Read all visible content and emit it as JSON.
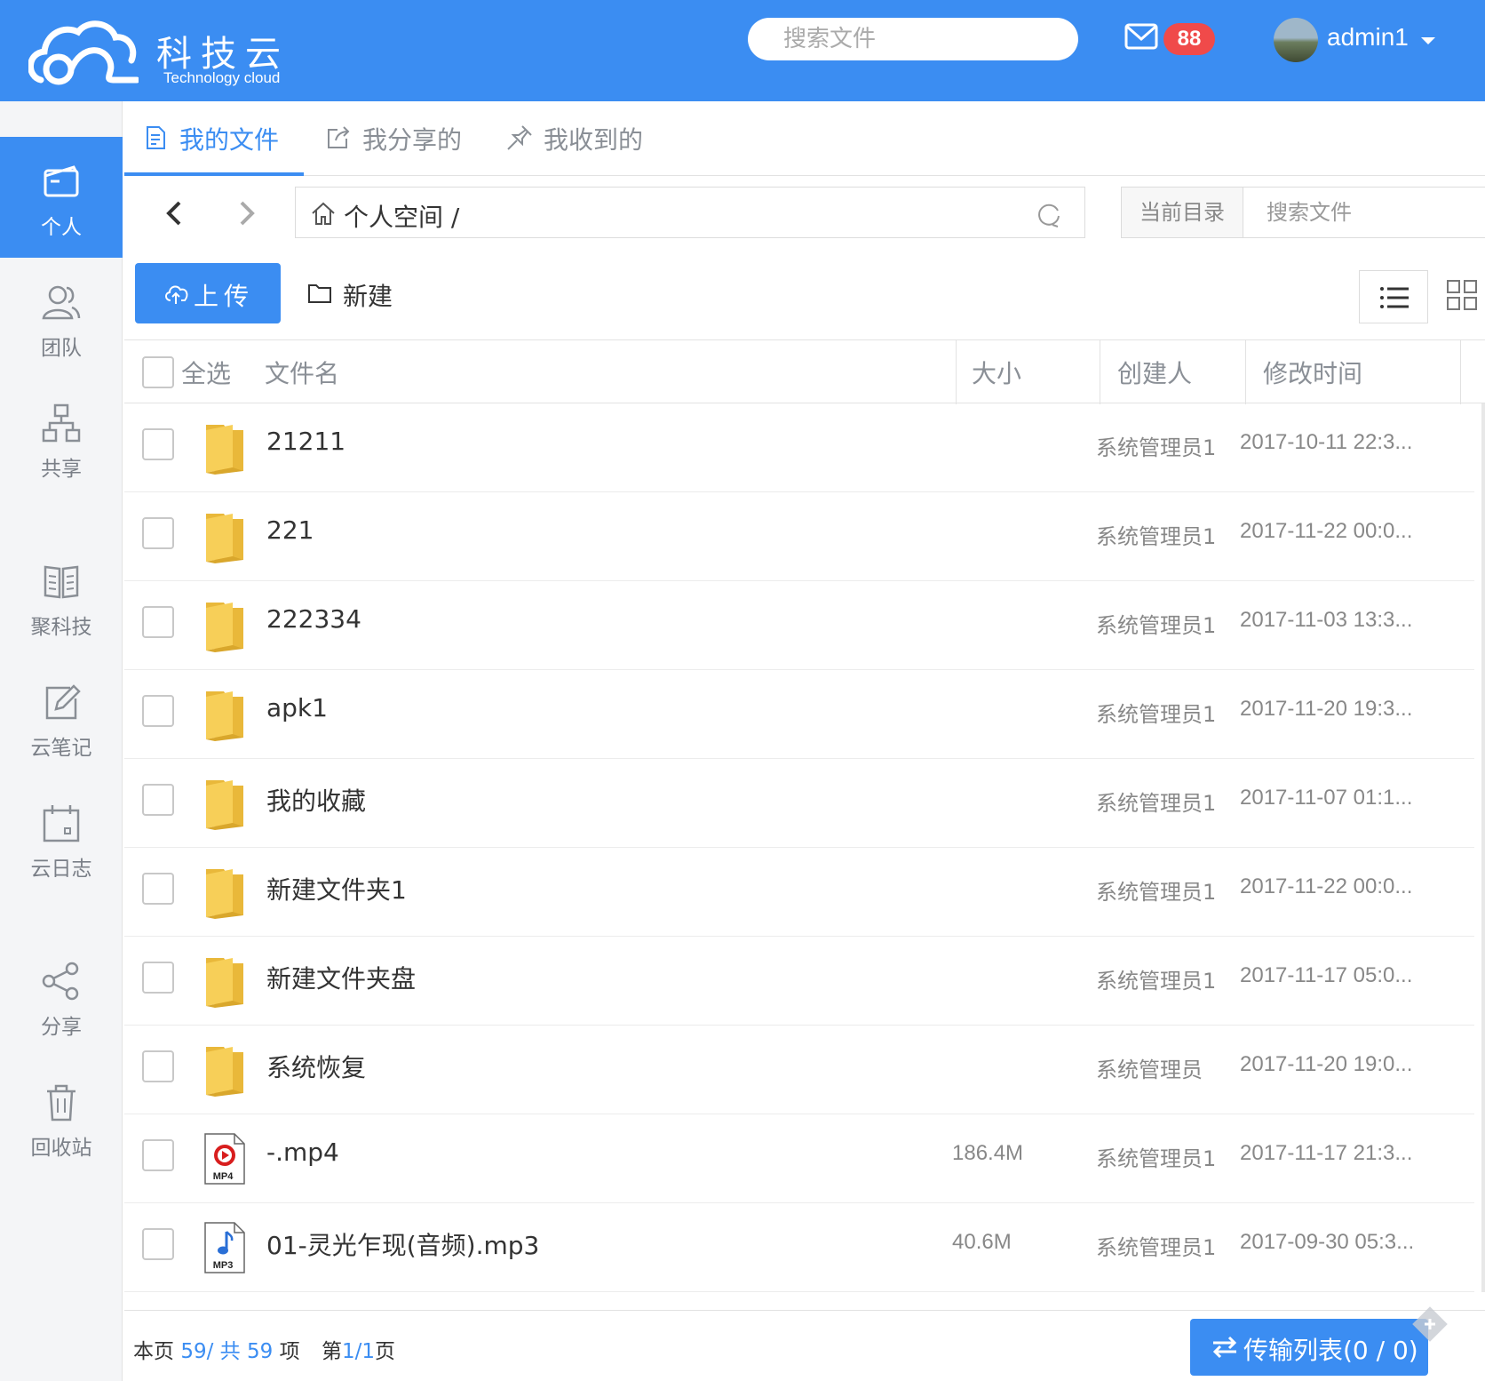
{
  "brand": {
    "title": "科技云",
    "subtitle": "Technology cloud"
  },
  "topbar": {
    "search_placeholder": "搜索文件",
    "mail_badge": "88",
    "username": "admin1"
  },
  "sidebar": {
    "items": [
      {
        "label": "个人",
        "icon": "wallet-icon",
        "active": true
      },
      {
        "label": "团队",
        "icon": "team-icon",
        "active": false
      },
      {
        "label": "共享",
        "icon": "org-chart-icon",
        "active": false
      },
      {
        "label": "聚科技",
        "icon": "book-icon",
        "active": false
      },
      {
        "label": "云笔记",
        "icon": "edit-note-icon",
        "active": false
      },
      {
        "label": "云日志",
        "icon": "calendar-icon",
        "active": false
      },
      {
        "label": "分享",
        "icon": "share-icon",
        "active": false
      },
      {
        "label": "回收站",
        "icon": "trash-icon",
        "active": false
      }
    ]
  },
  "tabs": [
    {
      "label": "我的文件",
      "icon": "file-icon",
      "active": true
    },
    {
      "label": "我分享的",
      "icon": "share-out-icon",
      "active": false
    },
    {
      "label": "我收到的",
      "icon": "pin-icon",
      "active": false
    }
  ],
  "nav": {
    "path": "个人空间 /",
    "scope_label": "当前目录",
    "search_placeholder": "搜索文件"
  },
  "toolbar": {
    "upload_label": "上传",
    "new_label": "新建"
  },
  "table": {
    "headers": {
      "select_all": "全选",
      "name": "文件名",
      "size": "大小",
      "creator": "创建人",
      "modified": "修改时间"
    },
    "rows": [
      {
        "name": "21211",
        "type": "folder",
        "size": "",
        "creator": "系统管理员1",
        "modified": "2017-10-11 22:3..."
      },
      {
        "name": "221",
        "type": "folder",
        "size": "",
        "creator": "系统管理员1",
        "modified": "2017-11-22 00:0..."
      },
      {
        "name": "222334",
        "type": "folder",
        "size": "",
        "creator": "系统管理员1",
        "modified": "2017-11-03 13:3..."
      },
      {
        "name": "apk1",
        "type": "folder",
        "size": "",
        "creator": "系统管理员1",
        "modified": "2017-11-20 19:3..."
      },
      {
        "name": "我的收藏",
        "type": "folder",
        "size": "",
        "creator": "系统管理员1",
        "modified": "2017-11-07 01:1..."
      },
      {
        "name": "新建文件夹1",
        "type": "folder",
        "size": "",
        "creator": "系统管理员1",
        "modified": "2017-11-22 00:0..."
      },
      {
        "name": "新建文件夹盘",
        "type": "folder",
        "size": "",
        "creator": "系统管理员1",
        "modified": "2017-11-17 05:0..."
      },
      {
        "name": "系统恢复",
        "type": "folder",
        "size": "",
        "creator": "系统管理员",
        "modified": "2017-11-20 19:0..."
      },
      {
        "name": "-.mp4",
        "type": "mp4",
        "icon_label": "MP4",
        "size": "186.4M",
        "creator": "系统管理员1",
        "modified": "2017-11-17 21:3..."
      },
      {
        "name": "01-灵光乍现(音频).mp3",
        "type": "mp3",
        "icon_label": "MP3",
        "size": "40.6M",
        "creator": "系统管理员1",
        "modified": "2017-09-30 05:3..."
      }
    ]
  },
  "footer": {
    "page_prefix": "本页",
    "page_count": "59",
    "total_prefix": "/ 共",
    "total_count": "59",
    "total_suffix": "项",
    "page_label": "第",
    "page_num": "1/1",
    "page_suffix": "页",
    "transfer_label": "传输列表(0 / 0)"
  },
  "colors": {
    "primary": "#3b8df2",
    "badge": "#f04a4a",
    "folder": "#f5c94c"
  }
}
